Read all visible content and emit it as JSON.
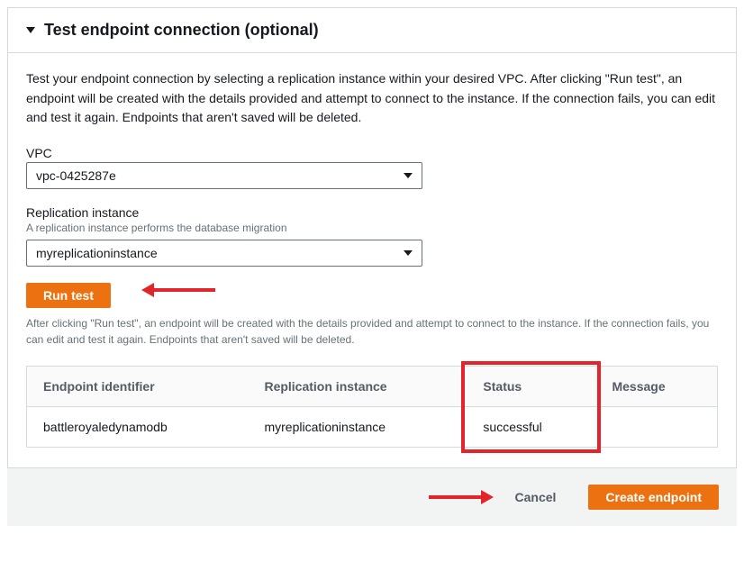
{
  "header": {
    "title": "Test endpoint connection (optional)"
  },
  "description": "Test your endpoint connection by selecting a replication instance within your desired VPC. After clicking \"Run test\", an endpoint will be created with the details provided and attempt to connect to the instance. If the connection fails, you can edit and test it again. Endpoints that aren't saved will be deleted.",
  "fields": {
    "vpc": {
      "label": "VPC",
      "value": "vpc-0425287e"
    },
    "replication": {
      "label": "Replication instance",
      "help": "A replication instance performs the database migration",
      "value": "myreplicationinstance"
    }
  },
  "actions": {
    "run_test": "Run test",
    "run_test_help": "After clicking \"Run test\", an endpoint will be created with the details provided and attempt to connect to the instance. If the connection fails, you can edit and test it again. Endpoints that aren't saved will be deleted."
  },
  "table": {
    "headers": {
      "endpoint": "Endpoint identifier",
      "replication": "Replication instance",
      "status": "Status",
      "message": "Message"
    },
    "rows": [
      {
        "endpoint": "battleroyaledynamodb",
        "replication": "myreplicationinstance",
        "status": "successful",
        "message": ""
      }
    ]
  },
  "footer": {
    "cancel": "Cancel",
    "create": "Create endpoint"
  }
}
